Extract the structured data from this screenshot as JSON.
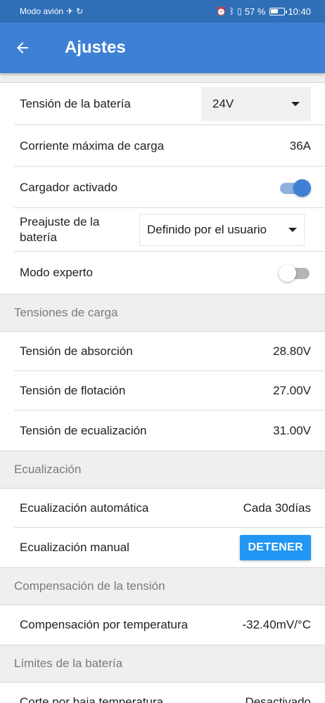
{
  "statusbar": {
    "left_text": "Modo avión",
    "battery": "57 %",
    "battery_level": 0.57,
    "time": "10:40"
  },
  "appbar": {
    "title": "Ajustes"
  },
  "rows": {
    "battery_voltage": {
      "label": "Tensión de la batería",
      "value": "24V"
    },
    "max_current": {
      "label": "Corriente máxima de carga",
      "value": "36A"
    },
    "charger_enabled": {
      "label": "Cargador activado",
      "on": true
    },
    "battery_preset": {
      "label": "Preajuste de la batería",
      "value": "Definido por el usuario"
    },
    "expert_mode": {
      "label": "Modo experto",
      "on": false
    }
  },
  "sections": {
    "charge_voltages": {
      "title": "Tensiones de carga",
      "absorption": {
        "label": "Tensión de absorción",
        "value": "28.80V"
      },
      "float": {
        "label": "Tensión de flotación",
        "value": "27.00V"
      },
      "equalization": {
        "label": "Tensión de ecualización",
        "value": "31.00V"
      }
    },
    "equalization": {
      "title": "Ecualización",
      "automatic": {
        "label": "Ecualización automática",
        "value": "Cada 30días"
      },
      "manual": {
        "label": "Ecualización manual",
        "button": "DETENER"
      }
    },
    "compensation": {
      "title": "Compensación de la tensión",
      "temperature": {
        "label": "Compensación por temperatura",
        "value": "-32.40mV/°C"
      }
    },
    "limits": {
      "title": "Límites de la batería",
      "low_temp_cutoff": {
        "label": "Corte por baja temperatura",
        "value": "Desactivado"
      }
    }
  },
  "colors": {
    "statusbar": "#2f6fb8",
    "appbar": "#3d80d4",
    "accent": "#2196f3",
    "section_bg": "#efefef"
  }
}
